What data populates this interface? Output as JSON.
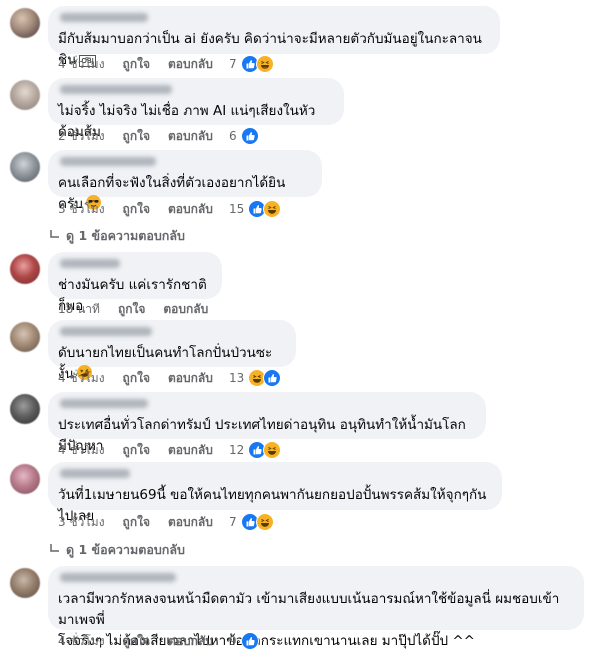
{
  "comments": [
    {
      "text": "มีกับส้มมาบอกว่าเป็น ai ยังครับ คิดว่าน่าจะมีหลายตัวกับมันอยู่ในกะลาจนชิน",
      "trailing_glyph": "OBJ",
      "time": "4 ชั่วโมง",
      "like": "ถูกใจ",
      "reply": "ตอบกลับ",
      "reaction_count": "7",
      "reaction_icons": [
        "like-icon",
        "haha-icon"
      ]
    },
    {
      "text": "ไม่จริ้ง ไม่จริง ไม่เชื่อ ภาพ AI แน่ๆเสียงในหัวด้อมส้ม",
      "time": "2 ชั่วโมง",
      "like": "ถูกใจ",
      "reply": "ตอบกลับ",
      "reaction_count": "6",
      "reaction_icons": [
        "like-icon"
      ]
    },
    {
      "text": "คนเลือกที่จะฟังในสิ่งที่ตัวเองอยากได้ยินครับ",
      "inline_emoji": "sunglasses-emoji",
      "time": "3 ชั่วโมง",
      "like": "ถูกใจ",
      "reply": "ตอบกลับ",
      "reaction_count": "15",
      "reaction_icons": [
        "like-icon",
        "haha-icon"
      ],
      "view_replies": "ดู 1 ข้อความตอบกลับ"
    },
    {
      "text": "ช่างมันครับ แค่เรารักชาติก็พอ",
      "time": "18 นาที",
      "like": "ถูกใจ",
      "reply": "ตอบกลับ"
    },
    {
      "text": "ดับนายกไทยเป็นคนทำโลกปั่นป่วนซะงั้น",
      "inline_emoji": "rofl-emoji",
      "time": "4 ชั่วโมง",
      "like": "ถูกใจ",
      "reply": "ตอบกลับ",
      "reaction_count": "13",
      "reaction_icons": [
        "haha-icon",
        "like-icon"
      ]
    },
    {
      "text": "ประเทศอื่นทั่วโลกด่าทรัมป์ ประเทศไทยด่าอนุทิน อนุทินทำให้น้ำมันโลกมีปัญหา",
      "time": "4 ชั่วโมง",
      "like": "ถูกใจ",
      "reply": "ตอบกลับ",
      "reaction_count": "12",
      "reaction_icons": [
        "like-icon",
        "haha-icon"
      ]
    },
    {
      "text": "วันที่1เมษายน69นี้ ขอให้คนไทยทุกคนพากันยกยอปอปั้นพรรคส้มให้จุกๆกันไปเลย",
      "time": "3 ชั่วโมง",
      "like": "ถูกใจ",
      "reply": "ตอบกลับ",
      "reaction_count": "7",
      "reaction_icons": [
        "like-icon",
        "haha-icon"
      ],
      "view_replies": "ดู 1 ข้อความตอบกลับ"
    },
    {
      "text": "เวลามีพวกรักหลงจนหน้ามืดตามัว เข้ามาเสียงแบบเน้นอารมณ์หาใช้ข้อมูลนี่ ผมชอบเข้ามาเพจพี่\nโจจริงๆ ไม่ต้องเสียเวลาไปหาข้อมูลกระแทกเขานานเลย มาปุ๊ปได้ปั๊ป ^^",
      "time": "4 ชั่วโมง",
      "like": "ถูกใจ",
      "reply": "ตอบกลับ",
      "reaction_count": "9",
      "reaction_icons": [
        "like-icon"
      ]
    }
  ],
  "colors": {
    "bubble": "#f0f2f5",
    "meta_text": "#65676b",
    "like_blue": "#1877f2",
    "haha_yellow": "#f7b125"
  }
}
